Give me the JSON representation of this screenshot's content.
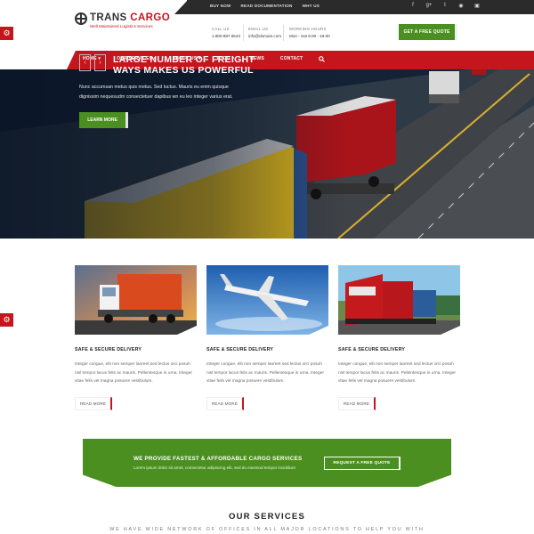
{
  "topbar": {
    "links": [
      "BUY NOW",
      "READ DOCUMENTATION",
      "WHY US"
    ],
    "social_icons": [
      "facebook-icon",
      "google-plus-icon",
      "twitter-icon",
      "dribbble-icon",
      "instagram-icon"
    ]
  },
  "brand": {
    "name_part1": "TRANS",
    "name_part2": "CARGO",
    "tagline": "Well Maintained Logistics Services",
    "accent_color": "#c4161c"
  },
  "header_info": [
    {
      "label": "CALL US",
      "value": "1.800.987.6543"
    },
    {
      "label": "EMAIL US",
      "value": "info@domain.com"
    },
    {
      "label": "WORKING HOURS",
      "value": "Mon - Sat 8.00 - 19.00"
    }
  ],
  "header_button": {
    "label": "GET A FREE QUOTE",
    "color": "#4a8f1f"
  },
  "nav": {
    "items": [
      "HOME ▾",
      "OUR SERVICES ▾",
      "ABOUT US ▾",
      "BLOG ▾",
      "NEWS",
      "CONTACT"
    ],
    "search_icon": "search-icon"
  },
  "hero": {
    "title_line1": "LARGE NUMBER OF FREIGHT",
    "title_line2": "WAYS MAKES US POWERFUL",
    "text_line1": "Nunc accumsan metus quis metus. Sed luctus. Mauris eu enim quisque",
    "text_line2": "dignissim nequesudm consectetuer dapibus wn eu leo integer varius erat.",
    "button_label": "LEARN MORE",
    "prev_arrow": "‹",
    "next_arrow": "›"
  },
  "features": [
    {
      "image": "truck",
      "title": "SAFE & SECURE DELIVERY",
      "text": "Integer congue, elit non semper laoreet sed lectus orci posuh nisl tempor lacus felis ac mauris. Pellentesque in urna. Integer vitae felis vel magna posuere vestibulum.",
      "button": "READ MORE"
    },
    {
      "image": "airplane",
      "title": "SAFE & SECURE DELIVERY",
      "text": "Integer congue, elit non semper laoreet sed lectus orci posuh nisl tempor lacus felis ac mauris. Pellentesque in urna. Integer vitae felis vel magna posuere vestibulum.",
      "button": "READ MORE"
    },
    {
      "image": "train",
      "title": "SAFE & SECURE DELIVERY",
      "text": "Integer congue, elit non semper laoreet sed lectus orci posuh nisl tempor lacus felis ac mauris. Pellentesque in urna. Integer vitae felis vel magna posuere vestibulum.",
      "button": "READ MORE"
    }
  ],
  "cta": {
    "title": "WE PROVIDE FASTEST & AFFORDABLE CARGO SERVICES",
    "subtitle": "Lorem ipsum dolor sit amet, consectetur adipiscing elit, sed do eiusmod tempor incididunt",
    "button": "REQUEST A FREE QUOTE"
  },
  "services": {
    "title": "OUR SERVICES",
    "subtitle": "WE HAVE WIDE NETWORK OF OFFICES IN ALL MAJOR LOCATIONS TO HELP YOU WITH"
  }
}
